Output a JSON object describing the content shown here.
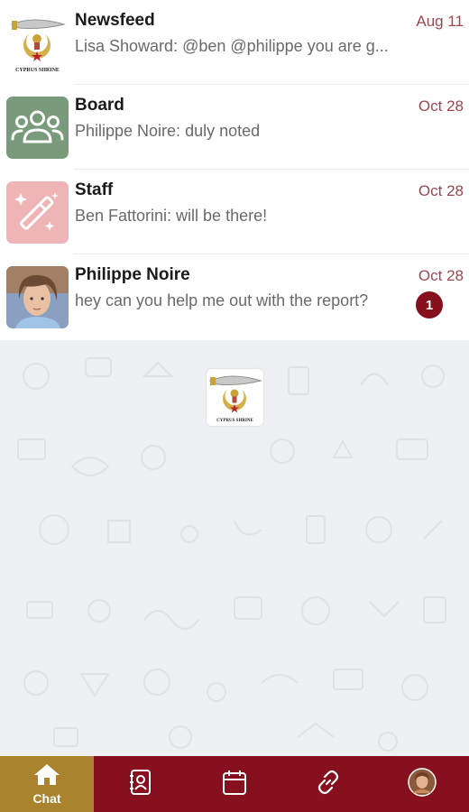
{
  "conversations": [
    {
      "title": "Newsfeed",
      "preview": "Lisa Showard: @ben @philippe you are g...",
      "date": "Aug 11",
      "avatar_icon": "cyprus-shrine-logo-icon"
    },
    {
      "title": "Board",
      "preview": "Philippe Noire: duly noted",
      "date": "Oct 28",
      "avatar_icon": "group-icon",
      "avatar_color": "#7a9a7c"
    },
    {
      "title": "Staff",
      "preview": "Ben Fattorini: will be there!",
      "date": "Oct 28",
      "avatar_icon": "magic-wand-icon",
      "avatar_color": "#eeb4b6"
    },
    {
      "title": "Philippe Noire",
      "preview": "hey can you help me out with the report?",
      "date": "Oct 28",
      "unread": "1",
      "avatar_icon": "user-photo"
    }
  ],
  "logo": {
    "caption": "CYPRUS SHRINE"
  },
  "tabbar": {
    "chat_label": "Chat",
    "icons": [
      "home-icon",
      "contacts-book-icon",
      "calendar-icon",
      "link-icon",
      "profile-avatar"
    ],
    "active_color": "#a9832e",
    "bar_color": "#86101e"
  },
  "colors": {
    "date": "#9b4750",
    "badge": "#86101e",
    "background_pattern": "#eef0f1"
  }
}
